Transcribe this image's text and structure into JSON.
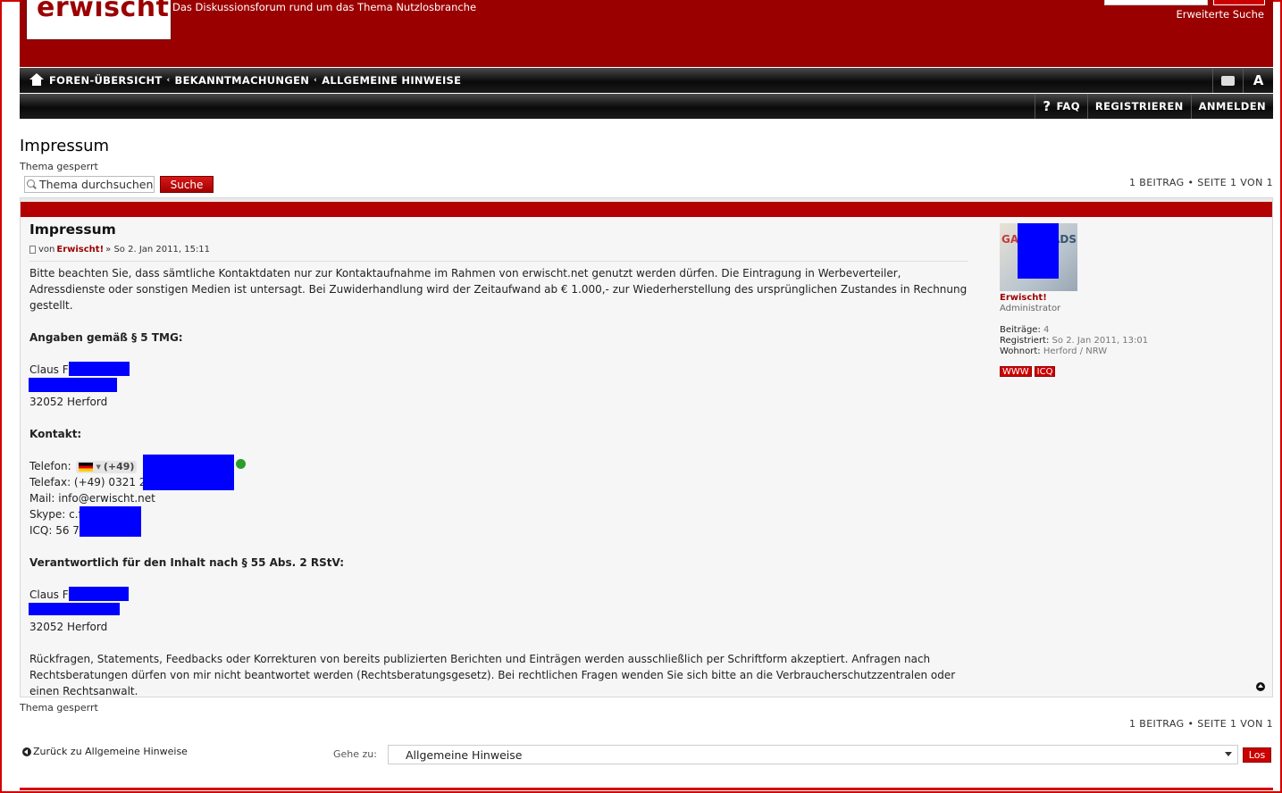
{
  "header": {
    "logo_text": "erwischt!",
    "site_description": "Das Diskussionsforum rund um das Thema Nutzlosbranche",
    "advanced_search": "Erweiterte Suche"
  },
  "breadcrumbs": [
    "FOREN-ÜBERSICHT",
    "BEKANNTMACHUNGEN",
    "ALLGEMEINE HINWEISE"
  ],
  "breadcrumb_separator": "‹",
  "nav_icons": [
    {
      "icon": "print-icon"
    },
    {
      "icon": "font-size-icon",
      "label": "A"
    }
  ],
  "user_nav": {
    "faq_icon": "?",
    "faq": "FAQ",
    "register": "REGISTRIEREN",
    "login": "ANMELDEN"
  },
  "topic": {
    "title": "Impressum",
    "locked_status": "Thema gesperrt",
    "search_placeholder": "Thema durchsuchen",
    "search_button": "Suche",
    "pagination": "1 BEITRAG • SEITE 1 VON 1"
  },
  "post": {
    "title": "Impressum",
    "meta_prefix": "von",
    "author": "Erwischt!",
    "meta_suffix": "» So 2. Jan 2011, 15:11",
    "intro": "Bitte beachten Sie, dass sämtliche Kontaktdaten nur zur Kontaktaufnahme im Rahmen von erwischt.net genutzt werden dürfen. Die Eintragung in Werbeverteiler, Adressdienste oder sonstigen Medien ist untersagt. Bei Zuwiderhandlung wird der Zeitaufwand ab € 1.000,- zur Wiederherstellung des ursprünglichen Zustandes in Rechnung gestellt.",
    "section_tmg": "Angaben gemäß § 5 TMG:",
    "name_1": "Claus F",
    "city_1": "32052 Herford",
    "section_contact": "Kontakt:",
    "phone_label": "Telefon:",
    "phone_prefix": "(+49)",
    "fax": "Telefax: (+49) 0321 2",
    "mail": "Mail: info@erwischt.net",
    "skype": "Skype: c.f",
    "icq": "ICQ: 56 77",
    "section_responsible": "Verantwortlich für den Inhalt nach § 55 Abs. 2 RStV:",
    "name_2": "Claus F",
    "city_2": "32052 Herford",
    "closing": "Rückfragen, Statements, Feedbacks oder Korrekturen von bereits publizierten Berichten und Einträgen werden ausschließlich per Schriftform akzeptiert. Anfragen nach Rechtsberatungen dürfen von mir nicht beantwortet werden (Rechtsberatungsgesetz). Bei rechtlichen Fragen wenden Sie sich bitte an die Verbraucherschutzzentralen oder einen Rechtsanwalt."
  },
  "profile": {
    "avatar_text_left": "GA-",
    "avatar_text_right": "ADS",
    "name": "Erwischt!",
    "rank": "Administrator",
    "posts_label": "Beiträge:",
    "posts_value": "4",
    "registered_label": "Registriert:",
    "registered_value": "So 2. Jan 2011, 13:01",
    "location_label": "Wohnort:",
    "location_value": "Herford / NRW",
    "www": "WWW",
    "icq": "ICQ"
  },
  "footer": {
    "locked_status": "Thema gesperrt",
    "pagination": "1 BEITRAG • SEITE 1 VON 1",
    "back_link": "Zurück zu Allgemeine Hinweise",
    "goto_label": "Gehe zu:",
    "goto_selected": "Allgemeine Hinweise",
    "go_button": "Los"
  },
  "colors": {
    "brand_red": "#9b0000",
    "redaction_blue": "#0000ff"
  }
}
